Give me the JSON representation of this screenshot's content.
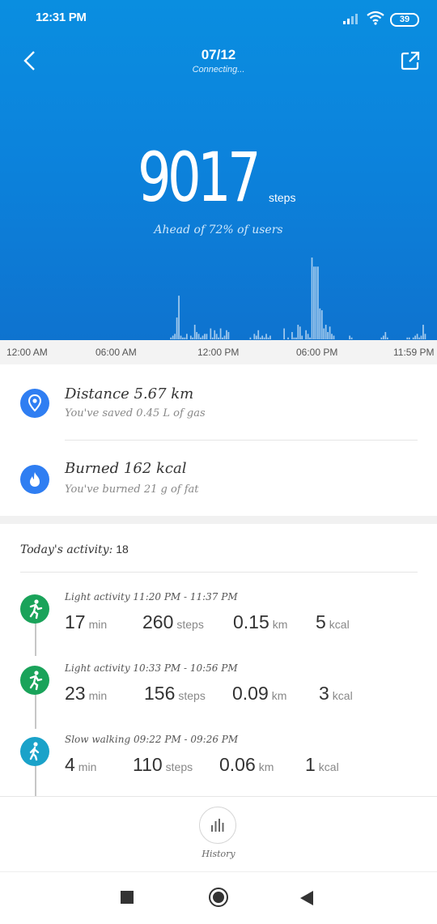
{
  "status_bar": {
    "time": "12:31 PM",
    "battery": "39"
  },
  "header": {
    "date": "07/12",
    "subtitle": "Connecting..."
  },
  "summary": {
    "steps": "9017",
    "steps_unit": "steps",
    "ahead_text": "Ahead of 72% of users"
  },
  "chart_data": {
    "type": "bar",
    "x_tick_labels": [
      "12:00 AM",
      "06:00 AM",
      "12:00 PM",
      "06:00 PM",
      "11:59 PM"
    ],
    "values": [
      0,
      0,
      0,
      0,
      0,
      0,
      0,
      0,
      0,
      0,
      0,
      0,
      0,
      0,
      0,
      0,
      0,
      0,
      0,
      0,
      0,
      0,
      0,
      0,
      0,
      0,
      0,
      0,
      0,
      0,
      0,
      0,
      0,
      0,
      0,
      0,
      0,
      0,
      0,
      0,
      0,
      0,
      0,
      0,
      0,
      0,
      0,
      0,
      0,
      0,
      0,
      0,
      0,
      0,
      0,
      0,
      0,
      0,
      0,
      0,
      0,
      0,
      0,
      0,
      0,
      0,
      0,
      0,
      0,
      0,
      0,
      0,
      0,
      0,
      0,
      0,
      0,
      0,
      0,
      0,
      1,
      2,
      3,
      12,
      24,
      2,
      1,
      1,
      3,
      0,
      2,
      1,
      8,
      4,
      3,
      1,
      2,
      3,
      3,
      0,
      6,
      1,
      5,
      3,
      1,
      6,
      1,
      2,
      5,
      4,
      0,
      0,
      0,
      0,
      0,
      0,
      0,
      0,
      0,
      0,
      1,
      0,
      3,
      2,
      5,
      1,
      2,
      1,
      3,
      1,
      2,
      0,
      0,
      0,
      0,
      0,
      0,
      6,
      0,
      1,
      0,
      4,
      1,
      1,
      8,
      7,
      2,
      0,
      5,
      3,
      1,
      45,
      40,
      40,
      40,
      17,
      16,
      6,
      8,
      4,
      7,
      3,
      2,
      0,
      0,
      0,
      0,
      0,
      0,
      0,
      2,
      1,
      0,
      0,
      0,
      0,
      0,
      0,
      0,
      0,
      0,
      0,
      0,
      0,
      0,
      0,
      1,
      2,
      4,
      1,
      0,
      0,
      0,
      0,
      0,
      0,
      0,
      0,
      0,
      1,
      1,
      0,
      1,
      2,
      3,
      1,
      2,
      8,
      3
    ],
    "ylim": [
      0,
      45
    ],
    "grid": false
  },
  "stats": [
    {
      "title": "Distance 5.67 km",
      "subtitle": "You've saved 0.45 L of gas",
      "icon": "location-pin-icon"
    },
    {
      "title": "Burned 162 kcal",
      "subtitle": "You've burned 21 g of fat",
      "icon": "flame-icon"
    }
  ],
  "activity": {
    "label": "Today's activity:",
    "count": "18",
    "items": [
      {
        "title": "Light activity 11:20 PM - 11:37 PM",
        "min": "17",
        "min_unit": "min",
        "steps": "260",
        "steps_unit": "steps",
        "km": "0.15",
        "km_unit": "km",
        "kcal": "5",
        "kcal_unit": "kcal",
        "color": "#1aa35a",
        "icon": "light-activity-icon"
      },
      {
        "title": "Light activity 10:33 PM - 10:56 PM",
        "min": "23",
        "min_unit": "min",
        "steps": "156",
        "steps_unit": "steps",
        "km": "0.09",
        "km_unit": "km",
        "kcal": "3",
        "kcal_unit": "kcal",
        "color": "#1aa35a",
        "icon": "light-activity-icon"
      },
      {
        "title": "Slow walking 09:22 PM - 09:26 PM",
        "min": "4",
        "min_unit": "min",
        "steps": "110",
        "steps_unit": "steps",
        "km": "0.06",
        "km_unit": "km",
        "kcal": "1",
        "kcal_unit": "kcal",
        "color": "#1aa2c9",
        "icon": "walking-icon"
      }
    ]
  },
  "bottom": {
    "history_label": "History"
  }
}
